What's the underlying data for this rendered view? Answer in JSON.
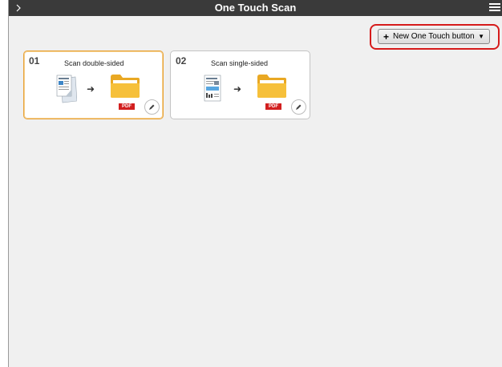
{
  "window": {
    "title": "One Touch Scan"
  },
  "toolbar": {
    "new_button_label": "New One Touch button"
  },
  "cards": [
    {
      "number": "01",
      "label": "Scan double-sided",
      "badge": "PDF",
      "selected": true
    },
    {
      "number": "02",
      "label": "Scan single-sided",
      "badge": "PDF",
      "selected": false
    }
  ],
  "colors": {
    "accent_border": "#e8a33a",
    "highlight": "#d61b1b",
    "pdf_badge": "#d21f1f",
    "folder": "#f6c03a"
  }
}
